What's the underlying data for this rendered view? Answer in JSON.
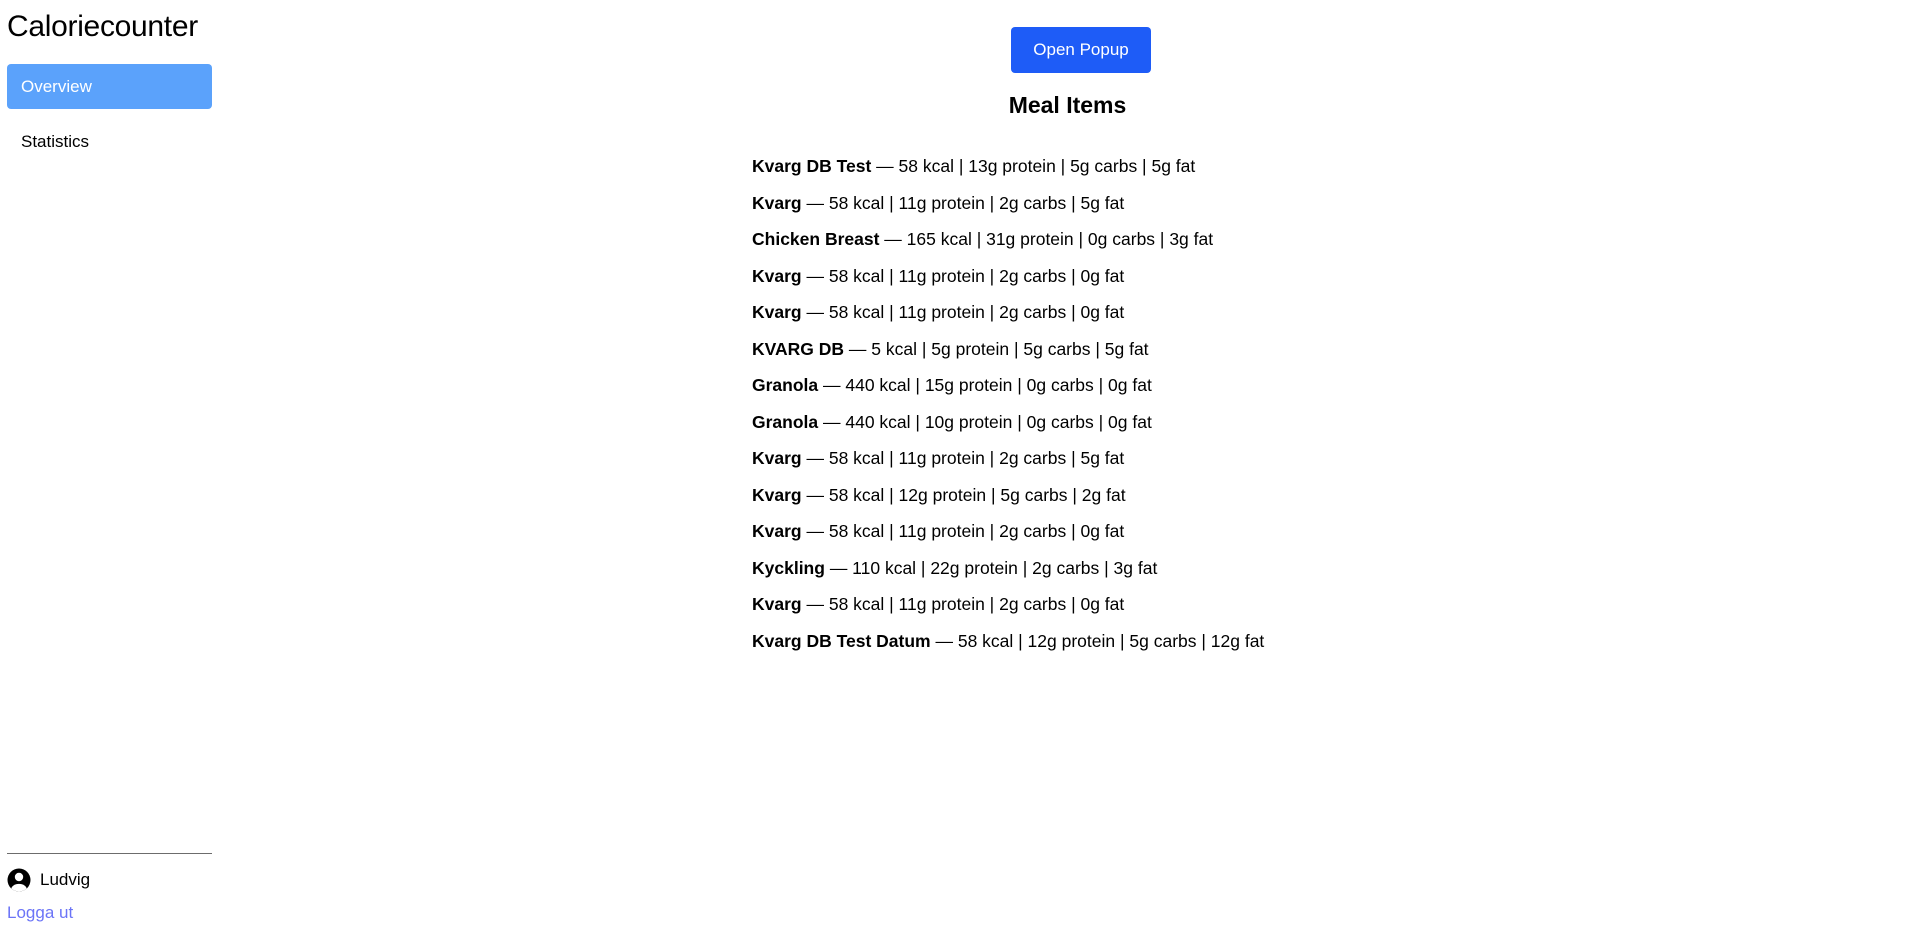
{
  "sidebar": {
    "app_title": "Caloriecounter",
    "nav": [
      {
        "label": "Overview",
        "active": true
      },
      {
        "label": "Statistics",
        "active": false
      }
    ],
    "user": {
      "icon": "user-circle-icon",
      "name": "Ludvig"
    },
    "logout_label": "Logga ut"
  },
  "main": {
    "popup_button_label": "Open Popup",
    "section_title": "Meal Items",
    "meal_items": [
      {
        "name": "Kvarg DB Test",
        "details": " — 58 kcal | 13g protein | 5g carbs | 5g fat"
      },
      {
        "name": "Kvarg",
        "details": " — 58 kcal | 11g protein | 2g carbs | 5g fat"
      },
      {
        "name": "Chicken Breast",
        "details": " — 165 kcal | 31g protein | 0g carbs | 3g fat"
      },
      {
        "name": "Kvarg",
        "details": " — 58 kcal | 11g protein | 2g carbs | 0g fat"
      },
      {
        "name": "Kvarg",
        "details": " — 58 kcal | 11g protein | 2g carbs | 0g fat"
      },
      {
        "name": "KVARG DB",
        "details": " — 5 kcal | 5g protein | 5g carbs | 5g fat"
      },
      {
        "name": "Granola",
        "details": " — 440 kcal | 15g protein | 0g carbs | 0g fat"
      },
      {
        "name": "Granola",
        "details": " — 440 kcal | 10g protein | 0g carbs | 0g fat"
      },
      {
        "name": "Kvarg",
        "details": " — 58 kcal | 11g protein | 2g carbs | 5g fat"
      },
      {
        "name": "Kvarg",
        "details": " — 58 kcal | 12g protein | 5g carbs | 2g fat"
      },
      {
        "name": "Kvarg",
        "details": " — 58 kcal | 11g protein | 2g carbs | 0g fat"
      },
      {
        "name": "Kyckling",
        "details": " — 110 kcal | 22g protein | 2g carbs | 3g fat"
      },
      {
        "name": "Kvarg",
        "details": " — 58 kcal | 11g protein | 2g carbs | 0g fat"
      },
      {
        "name": "Kvarg DB Test Datum",
        "details": " — 58 kcal | 12g protein | 5g carbs | 12g fat"
      }
    ]
  },
  "colors": {
    "active_nav_bg": "#5ba2fb",
    "primary_button": "#1e5cf7",
    "link": "#6b74f7"
  }
}
